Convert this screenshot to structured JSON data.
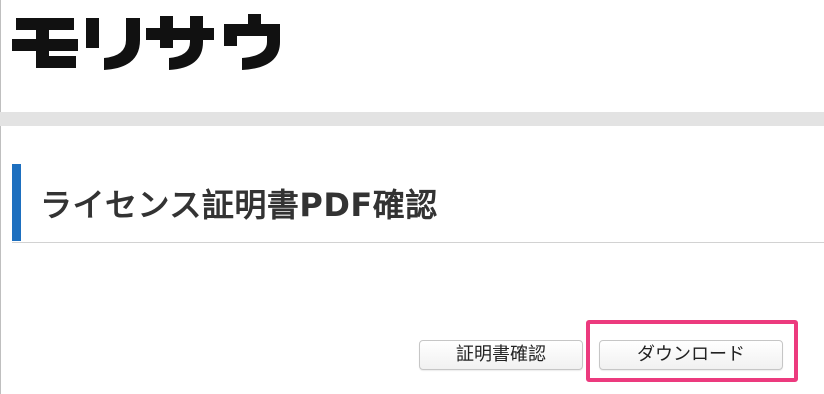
{
  "header": {
    "logo_text": "モリサワ",
    "logo_icon": "morisawa-logo"
  },
  "main": {
    "page_title": "ライセンス証明書PDF確認"
  },
  "actions": {
    "verify_label": "証明書確認",
    "download_label": "ダウンロード"
  },
  "colors": {
    "accent": "#1d6fbf",
    "highlight": "#ec3a7e",
    "band": "#e3e3e3",
    "title_text": "#333333"
  }
}
